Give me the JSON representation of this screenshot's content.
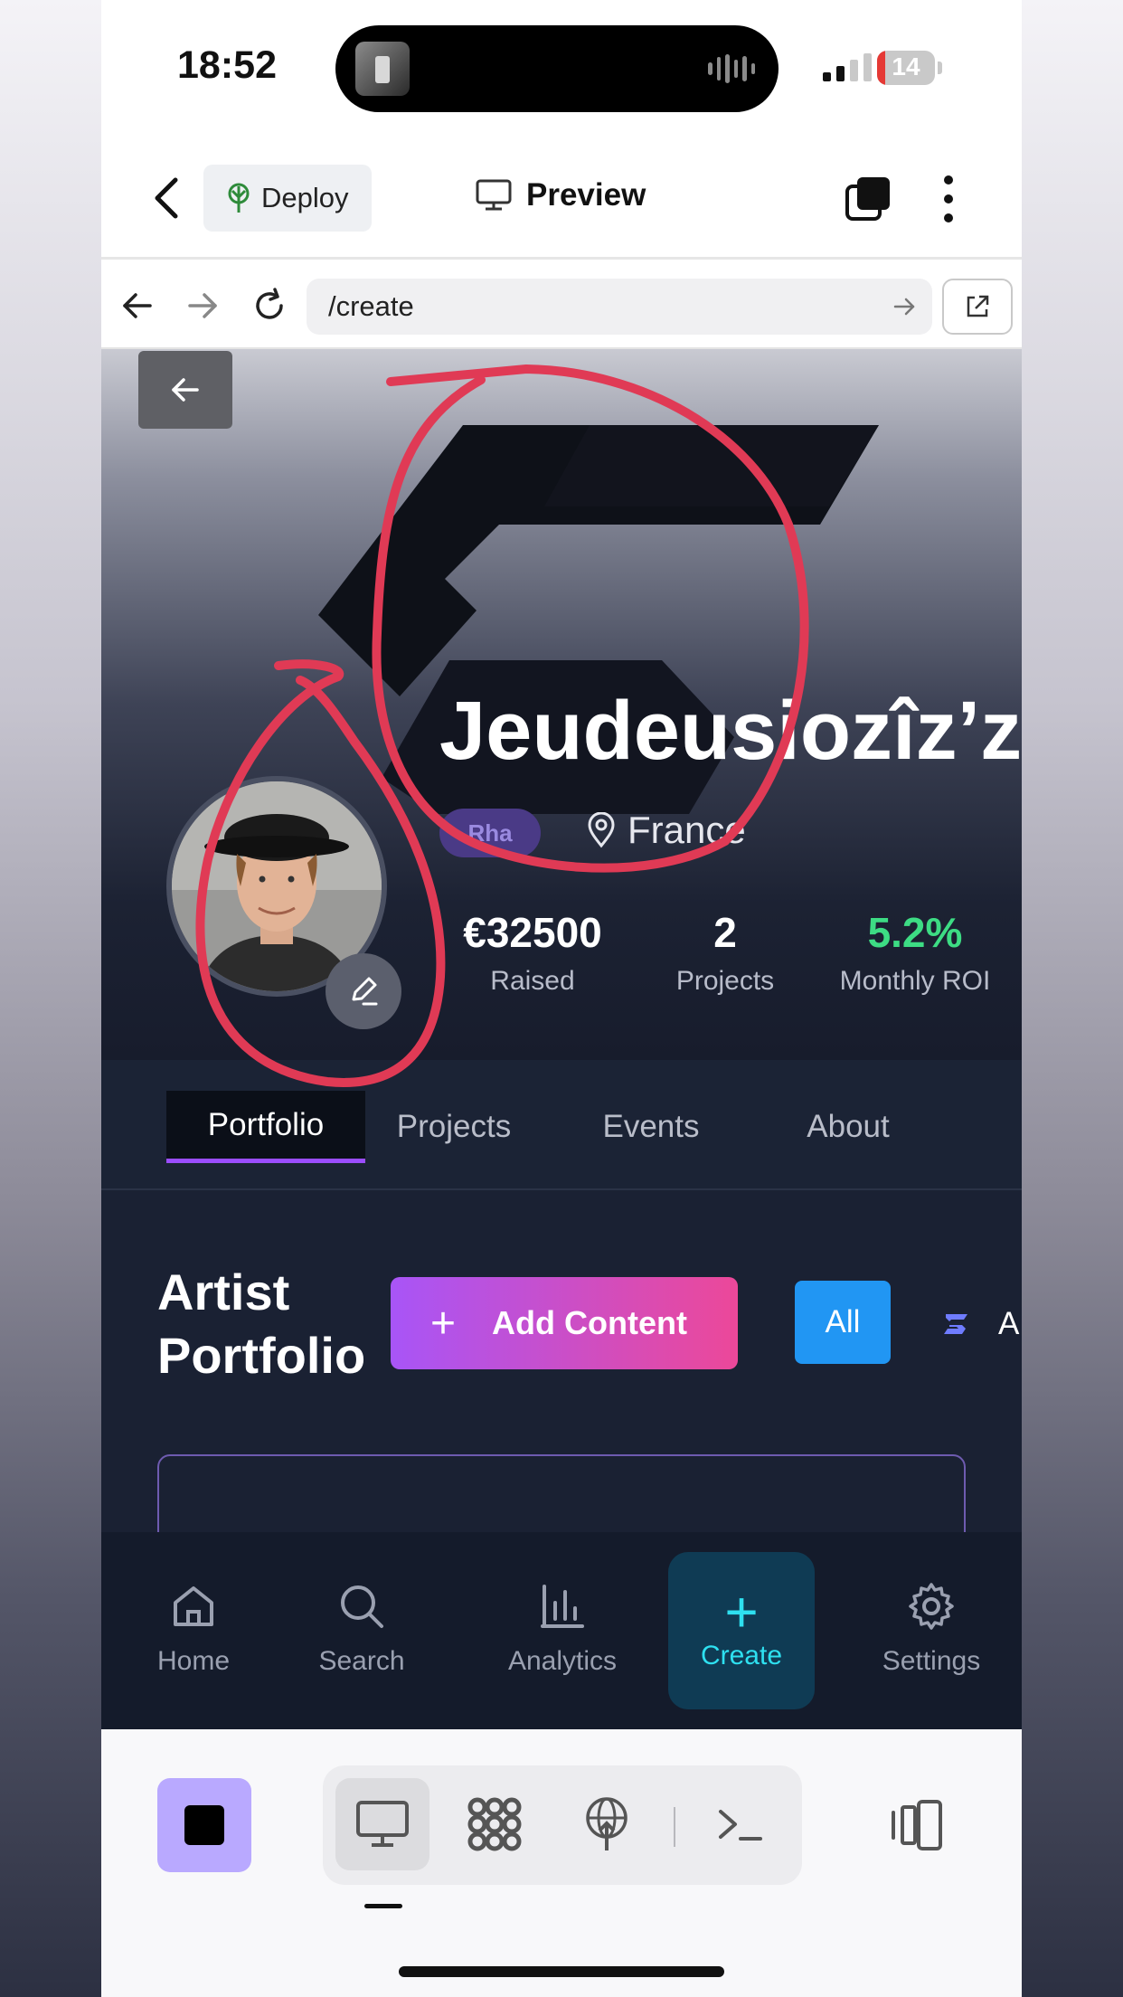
{
  "status_bar": {
    "time": "18:52",
    "battery_level": "14",
    "signal_icon": "cellular-signal-icon"
  },
  "app_header": {
    "deploy_label": "Deploy",
    "preview_label": "Preview"
  },
  "browser": {
    "url": "/create"
  },
  "profile": {
    "name": "Jeudeusiozîz’z",
    "role_badge": "Rha",
    "location": "France",
    "stats": [
      {
        "value": "€32500",
        "label": "Raised"
      },
      {
        "value": "2",
        "label": "Projects"
      },
      {
        "value": "5.2%",
        "label": "Monthly ROI"
      }
    ],
    "colors": {
      "roi_value": "#3ddc84",
      "accent": "#9b4dff"
    }
  },
  "tabs": [
    {
      "label": "Portfolio",
      "active": true
    },
    {
      "label": "Projects",
      "active": false
    },
    {
      "label": "Events",
      "active": false
    },
    {
      "label": "About",
      "active": false
    }
  ],
  "portfolio": {
    "title_line1": "Artist",
    "title_line2": "Portfolio",
    "add_content_label": "Add Content",
    "filter_all_label": "All",
    "filter_next_label": "A"
  },
  "bottom_nav": [
    {
      "label": "Home",
      "icon": "home-icon"
    },
    {
      "label": "Search",
      "icon": "search-icon"
    },
    {
      "label": "Analytics",
      "icon": "bar-chart-icon"
    },
    {
      "label": "Create",
      "icon": "plus-icon",
      "active": true
    },
    {
      "label": "Settings",
      "icon": "gear-icon"
    }
  ],
  "toolbar": {
    "icons": [
      "stop-icon",
      "monitor-icon",
      "grid-blob-icon",
      "deploy-globe-icon",
      "terminal-icon",
      "device-toggle-icon"
    ]
  }
}
